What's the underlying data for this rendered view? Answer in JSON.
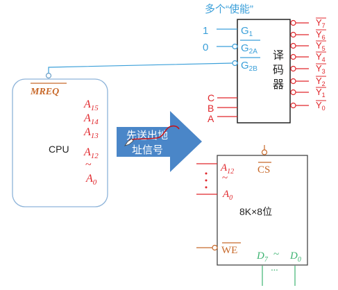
{
  "title": "多个“使能”",
  "decoder": {
    "label": [
      "译",
      "码",
      "器"
    ],
    "enable_inputs": [
      {
        "value": "1",
        "pin": "G",
        "sub": "1",
        "active_low": false
      },
      {
        "value": "0",
        "pin": "G",
        "sub": "2A",
        "active_low": true
      },
      {
        "value": "",
        "pin": "G",
        "sub": "2B",
        "active_low": true
      }
    ],
    "select_inputs": [
      "C",
      "B",
      "A"
    ],
    "outputs": [
      {
        "pin": "Y",
        "sub": "7"
      },
      {
        "pin": "Y",
        "sub": "6"
      },
      {
        "pin": "Y",
        "sub": "5"
      },
      {
        "pin": "Y",
        "sub": "4"
      },
      {
        "pin": "Y",
        "sub": "3"
      },
      {
        "pin": "Y",
        "sub": "2"
      },
      {
        "pin": "Y",
        "sub": "1"
      },
      {
        "pin": "Y",
        "sub": "0"
      }
    ]
  },
  "cpu": {
    "label": "CPU",
    "mreq": "MREQ",
    "address_lines": [
      {
        "pin": "A",
        "sub": "15"
      },
      {
        "pin": "A",
        "sub": "14"
      },
      {
        "pin": "A",
        "sub": "13"
      },
      {
        "pin": "A",
        "sub": "12"
      }
    ],
    "tilde": "~",
    "last_line": {
      "pin": "A",
      "sub": "0"
    }
  },
  "arrow": {
    "line1": "先送出地",
    "line2": "址信号",
    "color": "#4a86c8"
  },
  "memory": {
    "label": "8K×8位",
    "cs": "CS",
    "we": "WE",
    "addr_top": {
      "pin": "A",
      "sub": "12"
    },
    "addr_bottom": {
      "pin": "A",
      "sub": "0"
    },
    "tilde": "~",
    "data_label_start": {
      "pin": "D",
      "sub": "7"
    },
    "data_label_end": {
      "pin": "D",
      "sub": "0"
    },
    "data_tilde": "~",
    "dots": "···"
  },
  "colors": {
    "enable": "#3a9fd9",
    "address": "#e0262b",
    "control": "#c8692a",
    "data": "#3cb371"
  }
}
